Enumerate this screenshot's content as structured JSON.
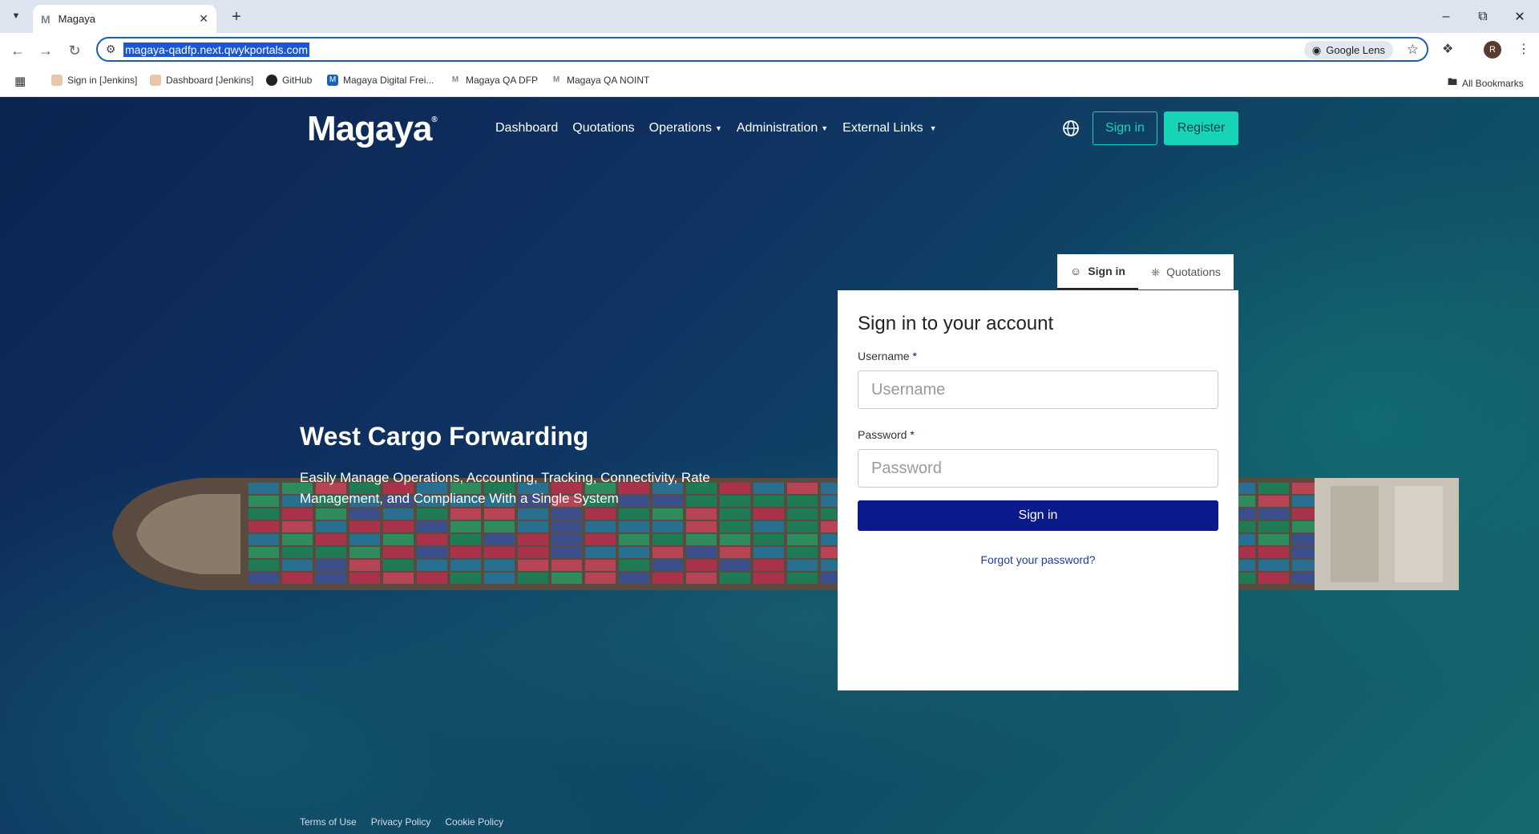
{
  "browser": {
    "tab_title": "Magaya",
    "tab_favicon": "M",
    "url": "magaya-qadfp.next.qwykportals.com",
    "lens_label": "Google Lens",
    "avatar_initial": "R",
    "bookmarks": [
      "Sign in [Jenkins]",
      "Dashboard [Jenkins]",
      "GitHub",
      "Magaya Digital Frei...",
      "Magaya QA DFP",
      "Magaya QA NOINT"
    ],
    "all_bookmarks": "All Bookmarks"
  },
  "site": {
    "logo": "Magaya",
    "nav": {
      "dashboard": "Dashboard",
      "quotations": "Quotations",
      "operations": "Operations",
      "administration": "Administration",
      "external_links": "External Links"
    },
    "sign_in": "Sign in",
    "register": "Register",
    "accent_color": "#17d3b8",
    "primary_color": "#0a1a8c"
  },
  "hero": {
    "title": "West Cargo Forwarding",
    "subtitle": "Easily Manage Operations, Accounting, Tracking, Connectivity, Rate Management, and Compliance With a Single System"
  },
  "panel": {
    "tabs": {
      "sign_in": "Sign in",
      "quotations": "Quotations"
    },
    "heading": "Sign in to your account",
    "username_label": "Username",
    "username_placeholder": "Username",
    "password_label": "Password",
    "password_placeholder": "Password",
    "required_mark": "*",
    "submit": "Sign in",
    "forgot": "Forgot your password?"
  },
  "footer": {
    "terms": "Terms of Use",
    "privacy": "Privacy Policy",
    "cookie": "Cookie Policy"
  }
}
